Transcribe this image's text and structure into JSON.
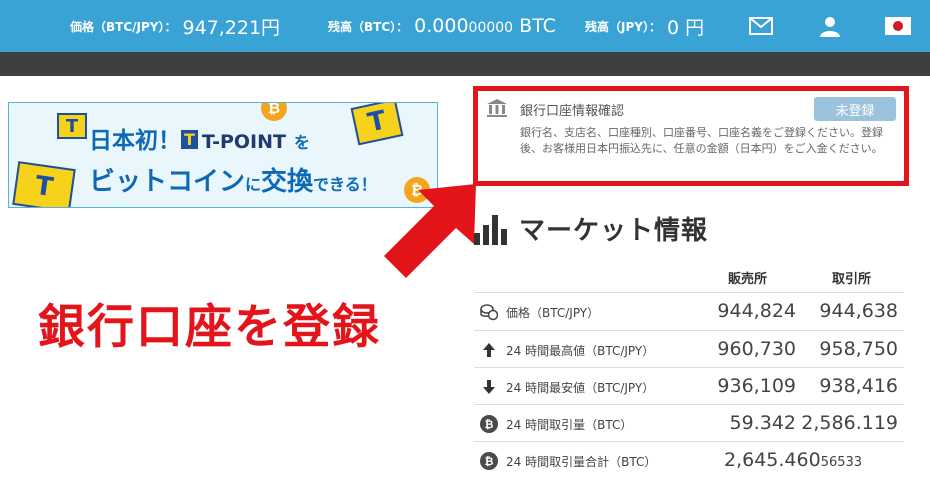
{
  "header": {
    "price": {
      "label": "価格（BTC/JPY）：",
      "value": "947,221円"
    },
    "balance_btc": {
      "label": "残高（BTC）：",
      "value_main": "0.000",
      "value_dim": "00000",
      "unit": " BTC"
    },
    "balance_jpy": {
      "label": "残高（JPY）：",
      "value": "0 円"
    },
    "icons": [
      "mail-icon",
      "user-icon",
      "japan-flag-icon"
    ]
  },
  "banner": {
    "line1_a": "日本初！",
    "line1_mark": "T",
    "line1_b": "T-POINT",
    "line1_c": "を",
    "line2_a": "ビットコイン",
    "line2_b": "に",
    "line2_c": "交換",
    "line2_d": "できる！",
    "coin_symbol": "₿"
  },
  "annotation": {
    "text": "銀行口座を登録"
  },
  "bank_info": {
    "title": "銀行口座情報確認",
    "badge": "未登録",
    "description": "銀行名、支店名、口座種別、口座番号、口座名義をご登録ください。登録後、お客様用日本円振込先に、任意の金額（日本円）をご入金ください。"
  },
  "market": {
    "title": "マーケット情報",
    "columns": [
      "販売所",
      "取引所"
    ],
    "rows": [
      {
        "icon": "coins-icon",
        "label": "価格（BTC/JPY）",
        "sales": "944,824",
        "exchange": "944,638"
      },
      {
        "icon": "arrow-up-icon",
        "label": "24 時間最高値（BTC/JPY）",
        "sales": "960,730",
        "exchange": "958,750"
      },
      {
        "icon": "arrow-down-icon",
        "label": "24 時間最安値（BTC/JPY）",
        "sales": "936,109",
        "exchange": "938,416"
      },
      {
        "icon": "bitcoin-icon",
        "label": "24 時間取引量（BTC）",
        "sales": "59.342",
        "exchange": "2,586.119"
      }
    ],
    "total_row": {
      "icon": "bitcoin-icon",
      "label": "24 時間取引量合計（BTC）",
      "value_main": "2,645.460",
      "value_dim": "56533"
    }
  },
  "colors": {
    "header_bg": "#3aa3d6",
    "annotation_red": "#e4141b",
    "badge_bg": "#9cc3de"
  }
}
